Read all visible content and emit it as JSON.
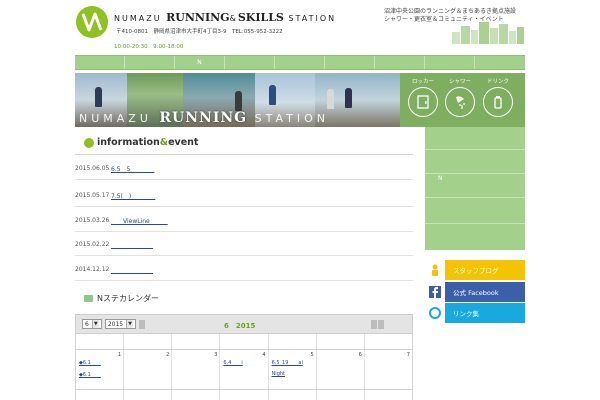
{
  "header": {
    "logo_text": "ヌマ",
    "brand_prefix": "NUMAZU",
    "brand_main": "RUNNING",
    "brand_amp": "&",
    "brand_skills": "SKILLS",
    "brand_suffix": "STATION",
    "address": "〒410-0801　静岡県沼津市大手町4丁目3-9　TEL:055-952-3222",
    "hours": "10:00-20:30　9:00-18:00",
    "tagline_line1": "沼津中央公園のランニング＆まちあるき拠点施設",
    "tagline_line2": "シャワー・更衣室＆コミュニティ・イベント"
  },
  "nav": {
    "items": [
      "",
      "",
      "N",
      "",
      "",
      "",
      "",
      "",
      ""
    ]
  },
  "hero": {
    "title_prefix": "NUMAZU",
    "title_main": "RUNNING",
    "title_suffix": "STATION",
    "amenities": [
      {
        "label": "ロッカー",
        "icon": "locker-icon"
      },
      {
        "label": "シャワー",
        "icon": "shower-icon"
      },
      {
        "label": "ドリンク",
        "icon": "drink-icon"
      }
    ]
  },
  "info": {
    "heading_a": "information",
    "heading_amp": " & ",
    "heading_b": "event",
    "news": [
      {
        "date": "2015.06.05",
        "link": "6.5　5　　　　"
      },
      {
        "date": "2015.05.17",
        "link": "7.5(　)　　　　"
      },
      {
        "date": "2015.03.26",
        "link": "　　ViewLine　　　"
      },
      {
        "date": "2015.02.22",
        "link": "　　　　　　　"
      },
      {
        "date": "2014.12.12",
        "link": "　　　　　　　"
      }
    ]
  },
  "calendar": {
    "heading": "Nステカレンダー",
    "month_value": "6",
    "year_value": "2015",
    "title": "6　2015",
    "days": [
      {
        "day": "1",
        "events": [
          "◆6.1　　",
          "◆6.1　　"
        ]
      },
      {
        "day": "2",
        "events": []
      },
      {
        "day": "3",
        "events": []
      },
      {
        "day": "4",
        "events": [
          "6.4　　i"
        ]
      },
      {
        "day": "5",
        "events": [
          "6.5_19　　al",
          "Night"
        ]
      },
      {
        "day": "6",
        "events": []
      },
      {
        "day": "7",
        "events": []
      }
    ]
  },
  "side": {
    "menu_label": "N",
    "banners": [
      {
        "label": "スタッフブログ",
        "color": "#f5c400",
        "icon": "person-icon"
      },
      {
        "label": "公式 Facebook",
        "color": "#3b5fa8",
        "icon": "facebook-icon"
      },
      {
        "label": "リンク集",
        "color": "#18a9df",
        "icon": "ring-icon"
      }
    ]
  },
  "colors": {
    "accent_green": "#8dc21f",
    "menu_green": "#a3d08a"
  }
}
